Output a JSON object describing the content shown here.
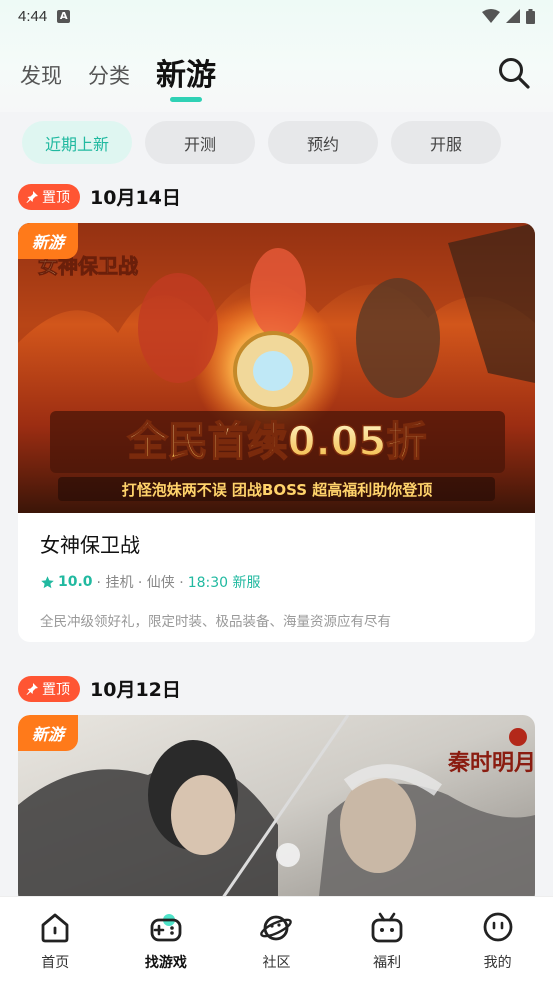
{
  "status_bar": {
    "time": "4:44",
    "notification_letter": "A"
  },
  "header": {
    "tabs": [
      {
        "label": "发现",
        "active": false
      },
      {
        "label": "分类",
        "active": false
      },
      {
        "label": "新游",
        "active": true
      }
    ],
    "search_icon": "search-icon"
  },
  "filters": [
    {
      "label": "近期上新",
      "active": true
    },
    {
      "label": "开测",
      "active": false
    },
    {
      "label": "预约",
      "active": false
    },
    {
      "label": "开服",
      "active": false
    }
  ],
  "sections": [
    {
      "pin_label": "置顶",
      "date": "10月14日",
      "card": {
        "badge": "新游",
        "banner_logo": "女神保卫战",
        "banner_headline": "全民首续0.05折",
        "banner_tagline": "打怪泡妹两不误  团战BOSS  超高福利助你登顶",
        "name": "女神保卫战",
        "rating": "10.0",
        "tags": "· 挂机 · 仙侠 ·",
        "server": "18:30 新服",
        "description": "全民冲级领好礼，限定时装、极品装备、海量资源应有尽有"
      }
    },
    {
      "pin_label": "置顶",
      "date": "10月12日",
      "card": {
        "badge": "新游",
        "banner_logo": "秦时明月"
      }
    }
  ],
  "bottom_nav": [
    {
      "label": "首页",
      "icon": "home-icon",
      "active": false
    },
    {
      "label": "找游戏",
      "icon": "gamepad-icon",
      "active": true
    },
    {
      "label": "社区",
      "icon": "planet-icon",
      "active": false
    },
    {
      "label": "福利",
      "icon": "tv-gift-icon",
      "active": false
    },
    {
      "label": "我的",
      "icon": "profile-face-icon",
      "active": false
    }
  ],
  "colors": {
    "accent": "#2fd1b5",
    "pin": "#ff5533",
    "new_badge": "#ff7a1a"
  }
}
